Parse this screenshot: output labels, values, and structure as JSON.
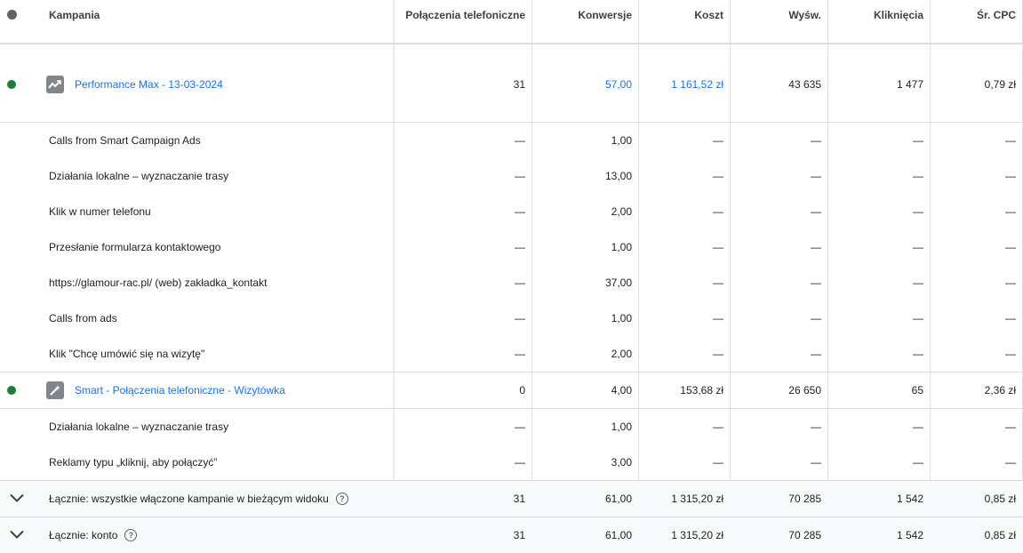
{
  "header": {
    "campaign": "Kampania",
    "phone_calls": "Połączenia telefoniczne",
    "conversions": "Konwersje",
    "cost": "Koszt",
    "impressions": "Wyśw.",
    "clicks": "Kliknięcia",
    "avg_cpc": "Śr. CPC"
  },
  "campaign1": {
    "name": "Performance Max - 13-03-2024",
    "phone_calls": "31",
    "conversions": "57,00",
    "cost": "1 161,52 zł",
    "impressions": "43 635",
    "clicks": "1 477",
    "avg_cpc": "0,79 zł",
    "status_color": "#188038",
    "icon": "performance-max-icon",
    "actions": [
      {
        "name": "Calls from Smart Campaign Ads",
        "phone_calls": "—",
        "conversions": "1,00",
        "cost": "—",
        "impressions": "—",
        "clicks": "—",
        "avg_cpc": "—"
      },
      {
        "name": "Działania lokalne – wyznaczanie trasy",
        "phone_calls": "—",
        "conversions": "13,00",
        "cost": "—",
        "impressions": "—",
        "clicks": "—",
        "avg_cpc": "—"
      },
      {
        "name": "Klik w numer telefonu",
        "phone_calls": "—",
        "conversions": "2,00",
        "cost": "—",
        "impressions": "—",
        "clicks": "—",
        "avg_cpc": "—"
      },
      {
        "name": "Przesłanie formularza kontaktowego",
        "phone_calls": "—",
        "conversions": "1,00",
        "cost": "—",
        "impressions": "—",
        "clicks": "—",
        "avg_cpc": "—"
      },
      {
        "name": "https://glamour-rac.pl/ (web) zakładka_kontakt",
        "phone_calls": "—",
        "conversions": "37,00",
        "cost": "—",
        "impressions": "—",
        "clicks": "—",
        "avg_cpc": "—"
      },
      {
        "name": "Calls from ads",
        "phone_calls": "—",
        "conversions": "1,00",
        "cost": "—",
        "impressions": "—",
        "clicks": "—",
        "avg_cpc": "—"
      },
      {
        "name": "Klik \"Chcę umówić się na wizytę\"",
        "phone_calls": "—",
        "conversions": "2,00",
        "cost": "—",
        "impressions": "—",
        "clicks": "—",
        "avg_cpc": "—"
      }
    ]
  },
  "campaign2": {
    "name": "Smart - Połączenia telefoniczne - Wizytówka",
    "phone_calls": "0",
    "conversions": "4,00",
    "cost": "153,68 zł",
    "impressions": "26 650",
    "clicks": "65",
    "avg_cpc": "2,36 zł",
    "status_color": "#188038",
    "icon": "smart-campaign-wand-icon",
    "actions": [
      {
        "name": "Działania lokalne – wyznaczanie trasy",
        "phone_calls": "—",
        "conversions": "1,00",
        "cost": "—",
        "impressions": "—",
        "clicks": "—",
        "avg_cpc": "—"
      },
      {
        "name": "Reklamy typu „kliknij, aby połączyć”",
        "phone_calls": "—",
        "conversions": "3,00",
        "cost": "—",
        "impressions": "—",
        "clicks": "—",
        "avg_cpc": "—"
      }
    ]
  },
  "totals": [
    {
      "label": "Łącznie: wszystkie włączone kampanie w bieżącym widoku",
      "phone_calls": "31",
      "conversions": "61,00",
      "cost": "1 315,20 zł",
      "impressions": "70 285",
      "clicks": "1 542",
      "avg_cpc": "0,85 zł"
    },
    {
      "label": "Łącznie: konto",
      "phone_calls": "31",
      "conversions": "61,00",
      "cost": "1 315,20 zł",
      "impressions": "70 285",
      "clicks": "1 542",
      "avg_cpc": "0,85 zł"
    }
  ]
}
